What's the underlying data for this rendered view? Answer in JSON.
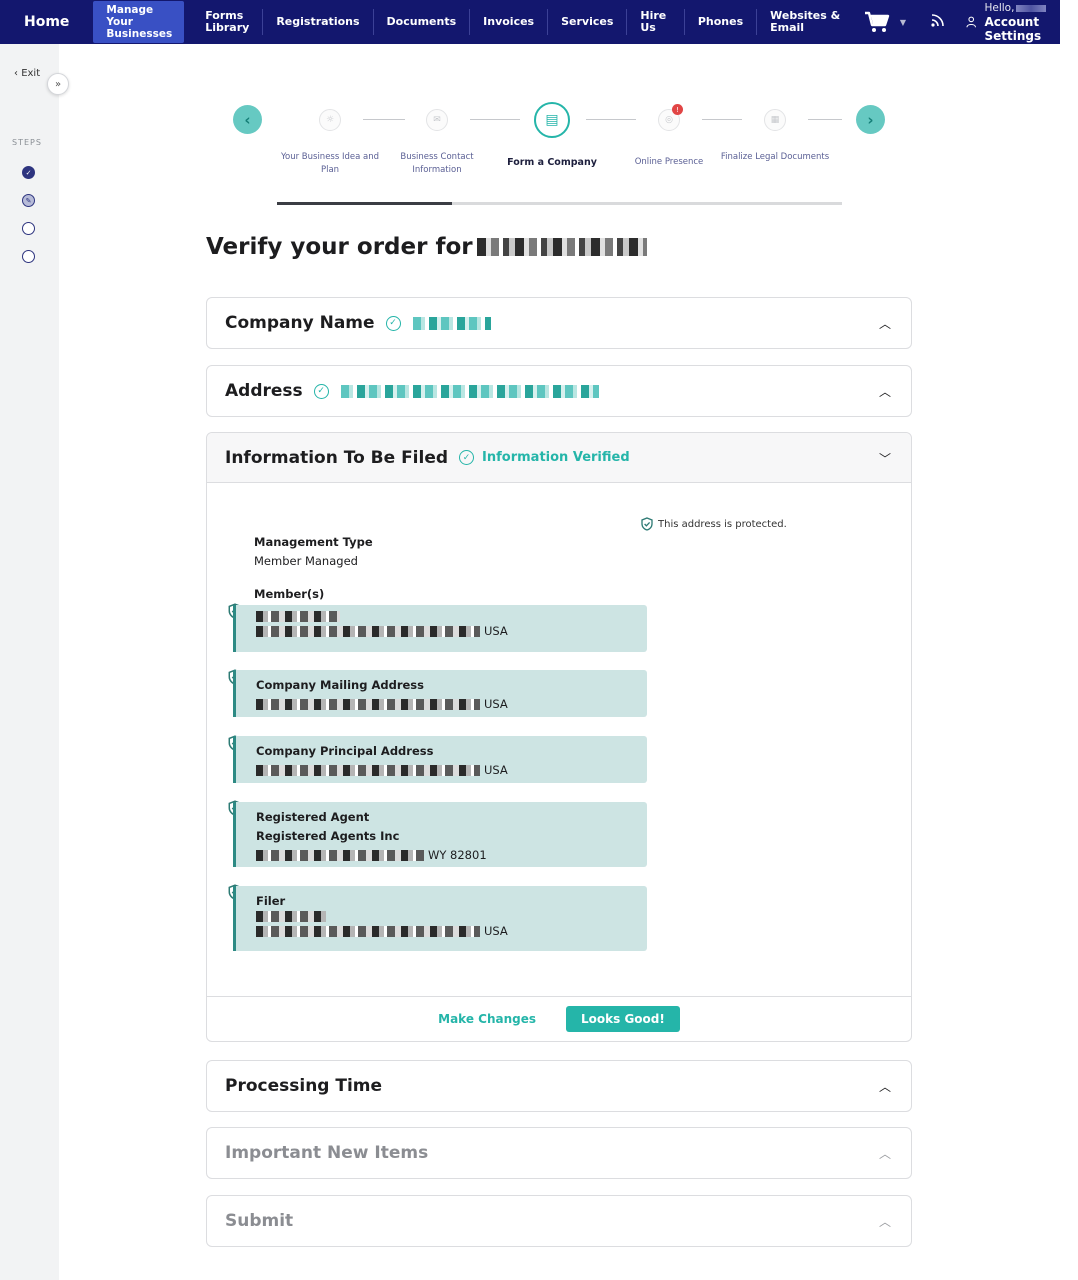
{
  "nav": {
    "home": "Home",
    "manage_line1": "Manage",
    "manage_line2": "Your Businesses",
    "forms_line1": "Forms",
    "forms_line2": "Library",
    "items": [
      "Registrations",
      "Documents",
      "Invoices",
      "Services",
      "Hire Us",
      "Phones",
      "Websites & Email"
    ],
    "hello": "Hello,",
    "account_settings": "Account Settings"
  },
  "sidebar": {
    "exit": "Exit",
    "steps_label": "STEPS"
  },
  "stepper": {
    "steps": [
      "Your Business Idea and Plan",
      "Business Contact Information",
      "Form a Company",
      "Online Presence",
      "Finalize Legal Documents"
    ],
    "active_index": 2,
    "progress_fraction": 0.31
  },
  "page": {
    "title": "Verify your order for"
  },
  "sections": {
    "company_name": "Company Name",
    "address": "Address",
    "info_filed": "Information To Be Filed",
    "info_verified": "Information Verified",
    "processing_time": "Processing Time",
    "important_new_items": "Important New Items",
    "submit": "Submit"
  },
  "info": {
    "protected_note": "This address is protected.",
    "management_type_label": "Management Type",
    "management_type_value": "Member Managed",
    "members_label": "Member(s)",
    "member_country": "USA",
    "mailing_label": "Company Mailing Address",
    "mailing_country": "USA",
    "principal_label": "Company Principal Address",
    "principal_country": "USA",
    "agent_label": "Registered Agent",
    "agent_name": "Registered Agents Inc",
    "agent_state_zip": "WY 82801",
    "filer_label": "Filer",
    "filer_country": "USA"
  },
  "actions": {
    "make_changes": "Make Changes",
    "looks_good": "Looks Good!"
  },
  "colors": {
    "nav_bg": "#13176e",
    "accent_teal": "#25b5a9",
    "info_box_bg": "#cde4e3"
  }
}
